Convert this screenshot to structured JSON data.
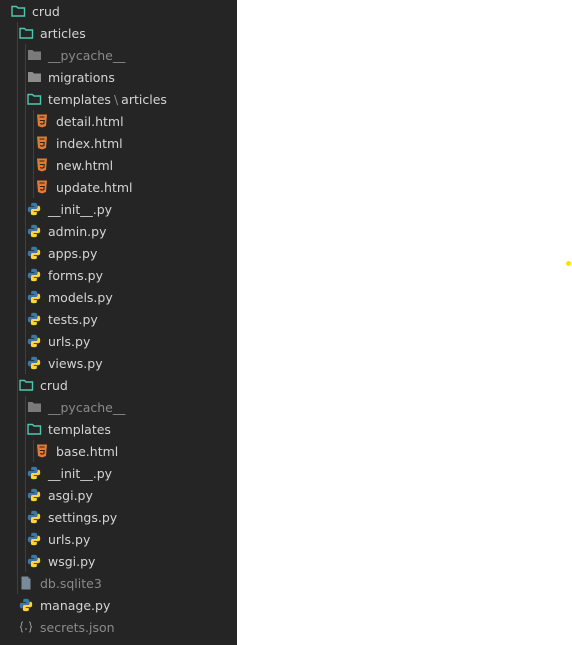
{
  "explorer": {
    "root": {
      "label": "crud"
    },
    "articles": {
      "label": "articles",
      "pycache": "__pycache__",
      "migrations": "migrations",
      "templates": {
        "label": "templates",
        "separator": "\\",
        "sub": "articles"
      },
      "html_files": [
        "detail.html",
        "index.html",
        "new.html",
        "update.html"
      ],
      "py_files": [
        "__init__.py",
        "admin.py",
        "apps.py",
        "forms.py",
        "models.py",
        "tests.py",
        "urls.py",
        "views.py"
      ]
    },
    "crud_pkg": {
      "label": "crud",
      "pycache": "__pycache__",
      "templates": {
        "label": "templates"
      },
      "html_files": [
        "base.html"
      ],
      "py_files": [
        "__init__.py",
        "asgi.py",
        "settings.py",
        "urls.py",
        "wsgi.py"
      ]
    },
    "root_files": {
      "db": "db.sqlite3",
      "manage": "manage.py",
      "secrets": "secrets.json"
    }
  },
  "colors": {
    "sidebar_bg": "#252526",
    "text": "#d4d4d4",
    "dim_text": "#8a8a8a",
    "folder_open": "#4ec9b0",
    "folder_closed": "#8c8c8c",
    "html_icon": "#e37933",
    "python_blue": "#3b77a8",
    "python_yellow": "#ffd43b"
  },
  "icons": {
    "open_folder": "folder-open-icon",
    "closed_folder": "folder-icon",
    "html": "html5-icon",
    "python": "python-icon",
    "database": "database-icon",
    "json": "json-icon"
  }
}
